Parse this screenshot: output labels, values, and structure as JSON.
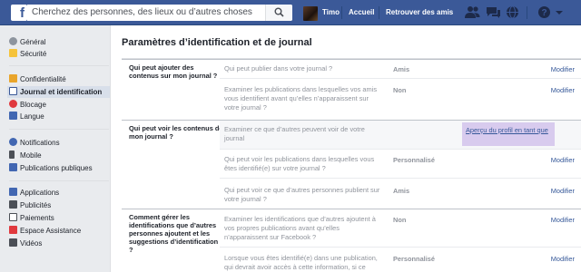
{
  "topbar": {
    "search_placeholder": "Cherchez des personnes, des lieux ou d’autres choses",
    "user_name": "Timo",
    "home_label": "Accueil",
    "find_friends_label": "Retrouver des amis",
    "icons": [
      "friend-requests-icon",
      "messages-icon",
      "notifications-icon",
      "help-icon",
      "menu-icon"
    ]
  },
  "sidebar": {
    "group1": [
      {
        "label": "Général",
        "icon": "gear-icon"
      },
      {
        "label": "Sécurité",
        "icon": "shield-icon"
      }
    ],
    "group2": [
      {
        "label": "Confidentialité",
        "icon": "lock-icon"
      },
      {
        "label": "Journal et identification",
        "icon": "timeline-icon",
        "active": true
      },
      {
        "label": "Blocage",
        "icon": "block-icon"
      },
      {
        "label": "Langue",
        "icon": "language-icon"
      }
    ],
    "group3": [
      {
        "label": "Notifications",
        "icon": "globe-icon"
      },
      {
        "label": "Mobile",
        "icon": "mobile-icon"
      },
      {
        "label": "Publications publiques",
        "icon": "rss-icon"
      }
    ],
    "group4": [
      {
        "label": "Applications",
        "icon": "apps-icon"
      },
      {
        "label": "Publicités",
        "icon": "ads-icon"
      },
      {
        "label": "Paiements",
        "icon": "payments-icon"
      },
      {
        "label": "Espace Assistance",
        "icon": "support-icon"
      },
      {
        "label": "Vidéos",
        "icon": "video-icon"
      }
    ]
  },
  "main": {
    "title": "Paramètres d’identification et de journal",
    "sections": [
      {
        "label": "Qui peut ajouter des contenus sur mon journal ?",
        "rows": [
          {
            "question": "Qui peut publier dans votre journal ?",
            "value": "Amis",
            "action": "Modifier"
          },
          {
            "question": "Examiner les publications dans lesquelles vos amis vous identifient avant qu’elles n’apparaissent sur votre journal ?",
            "value": "Non",
            "action": "Modifier"
          }
        ]
      },
      {
        "label": "Qui peut voir les contenus de mon journal ?",
        "rows": [
          {
            "question": "Examiner ce que d’autres peuvent voir de votre journal",
            "value": "",
            "action": "Aperçu du profil en tant que"
          },
          {
            "question": "Qui peut voir les publications dans lesquelles vous êtes identifié(e) sur votre journal ?",
            "value": "Personnalisé",
            "action": "Modifier"
          },
          {
            "question": "Qui peut voir ce que d’autres personnes publient sur votre journal ?",
            "value": "Amis",
            "action": "Modifier"
          }
        ]
      },
      {
        "label": "Comment gérer les identifications que d’autres personnes ajoutent et les suggestions d’identification ?",
        "rows": [
          {
            "question": "Examiner les identifications que d’autres ajoutent à vos propres publications avant qu’elles n’apparaissent sur Facebook ?",
            "value": "Non",
            "action": "Modifier"
          },
          {
            "question": "Lorsque vous êtes identifié(e) dans une publication, qui devrait avoir accès à cette information, si ce",
            "value": "Personnalisé",
            "action": "Modifier"
          }
        ]
      }
    ]
  }
}
